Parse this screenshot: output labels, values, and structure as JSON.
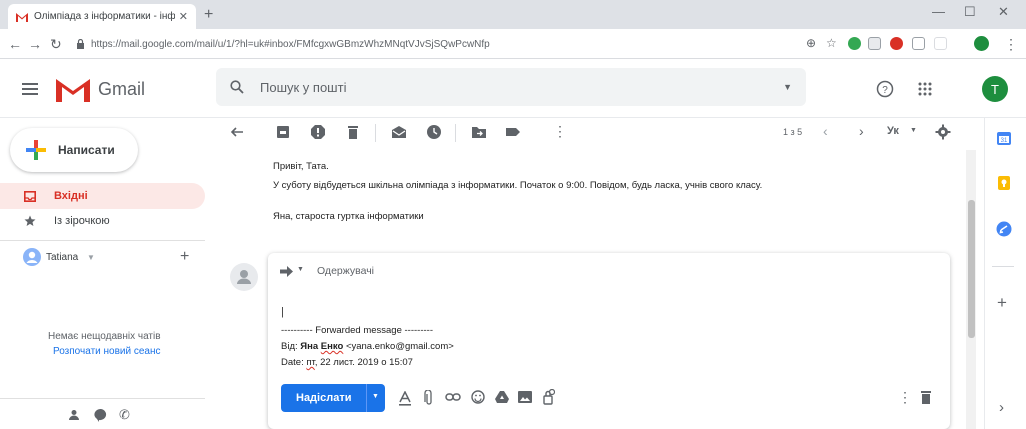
{
  "browser": {
    "tab_title": "Олімпіада з інформатики - інфо",
    "url": "https://mail.google.com/mail/u/1/?hl=uk#inbox/FMfcgxwGBmzWhzMNqtVJvSjSQwPcwNfp"
  },
  "app": {
    "name": "Gmail"
  },
  "search": {
    "placeholder": "Пошук у пошті"
  },
  "profile": {
    "initial": "T"
  },
  "compose": {
    "label": "Написати"
  },
  "sidebar": {
    "items": [
      {
        "label": "Вхідні",
        "icon": "inbox-icon",
        "active": true
      },
      {
        "label": "Із зірочкою",
        "icon": "star-icon",
        "active": false
      }
    ],
    "account": "Tatiana",
    "chat_empty": "Немає нещодавніх чатів",
    "chat_start": "Розпочати новий сеанс"
  },
  "toolbar": {
    "pager": "1 з 5",
    "lang": "Ук"
  },
  "message": {
    "greeting": "Привіт, Тата.",
    "body": "У суботу відбудеться шкільна олімпіада з інформатики. Початок о 9:00. Повідом, будь ласка, учнів свого класу.",
    "signature": "Яна, староста гуртка інформатики"
  },
  "reply": {
    "recipients_label": "Одержувачі",
    "cursor": "|",
    "forwarded": "---------- Forwarded message ---------",
    "from_label": "Від:",
    "from_first": "Яна",
    "from_last": "Енко",
    "from_email": "<yana.enko@gmail.com>",
    "date_label": "Date:",
    "date_day": "пт",
    "date_value": ", 22 лист. 2019 о 15:07",
    "send_label": "Надіслати"
  },
  "colors": {
    "accent": "#1a73e8",
    "gmail_red": "#d93025",
    "avatar_green": "#1e8e3e"
  }
}
